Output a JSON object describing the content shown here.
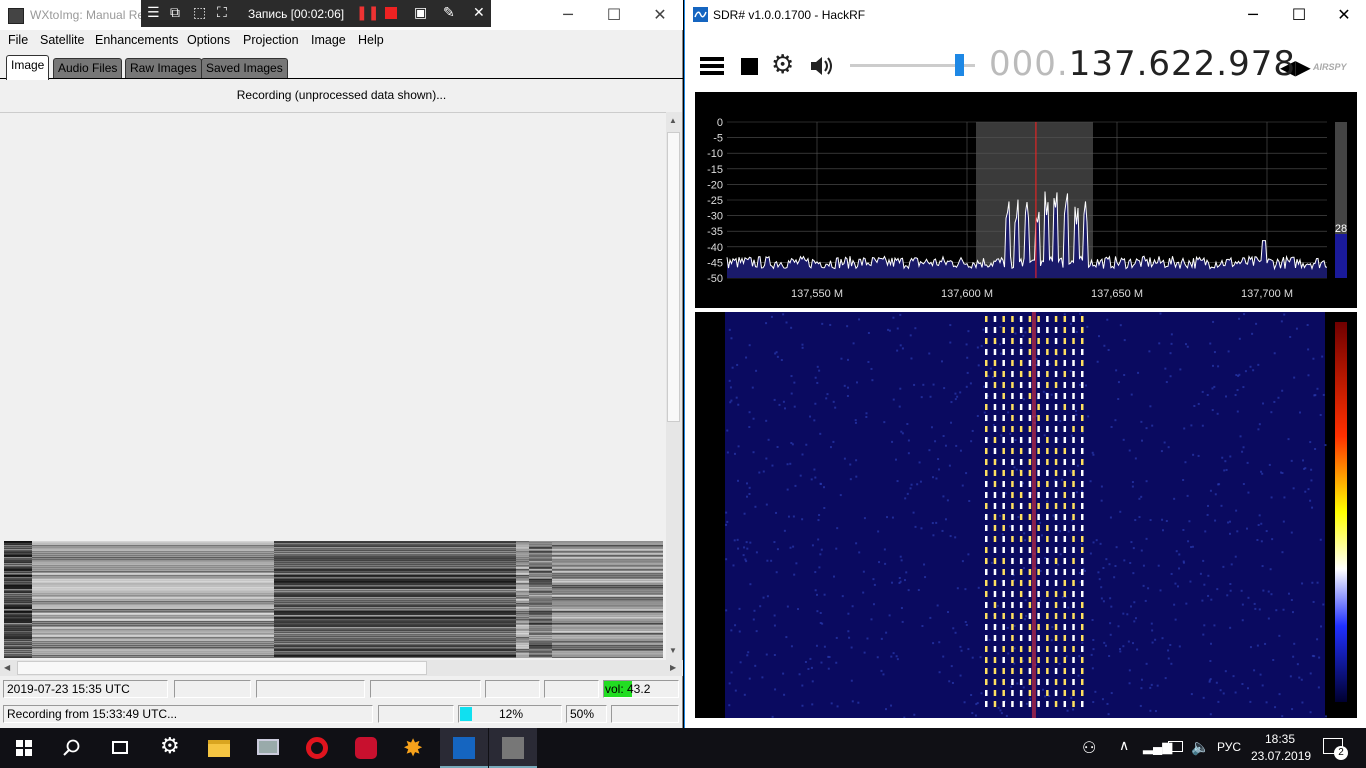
{
  "wx": {
    "title": "WXtoImg: Manual Re",
    "menu": [
      "File",
      "Satellite",
      "Enhancements",
      "Options",
      "Projection",
      "Image",
      "Help"
    ],
    "tabs": [
      "Image",
      "Audio Files",
      "Raw Images",
      "Saved Images"
    ],
    "status_message": "Recording (unprocessed data shown)...",
    "status_row1": {
      "datetime": "2019-07-23  15:35 UTC",
      "vol": "vol: 43.2"
    },
    "status_row2": {
      "recording": "Recording from 15:33:49 UTC...",
      "progress": "12%",
      "progress_value": 0.12,
      "level": "50%"
    }
  },
  "recorder": {
    "label": "Запись [00:02:06]"
  },
  "sdr": {
    "title": "SDR# v1.0.0.1700 - HackRF",
    "freq_dim": "000.",
    "freq_main": "137.622.978",
    "logo": "AIRSPY",
    "colors": {
      "spectrum_bg": "#000000",
      "trace": "#ffffff",
      "fill": "#1a1a6a",
      "center_line": "#ff2020",
      "filter": "#3a3a3a"
    }
  },
  "chart_data": {
    "type": "line",
    "y_ticks": [
      "0",
      "-5",
      "-10",
      "-15",
      "-20",
      "-25",
      "-30",
      "-35",
      "-40",
      "-45",
      "-50"
    ],
    "x_ticks": [
      "137,550 M",
      "137,600 M",
      "137,650 M",
      "137,700 M"
    ],
    "ylim": [
      -50,
      0
    ],
    "xlim_mhz": [
      137.52,
      137.72
    ],
    "center_mhz": 137.622978,
    "filter_mhz": [
      137.603,
      137.642
    ],
    "level_indicator": "28",
    "noise_floor": -45
  },
  "taskbar": {
    "lang": "РУС",
    "time": "18:35",
    "date": "23.07.2019",
    "notif_count": "2"
  }
}
